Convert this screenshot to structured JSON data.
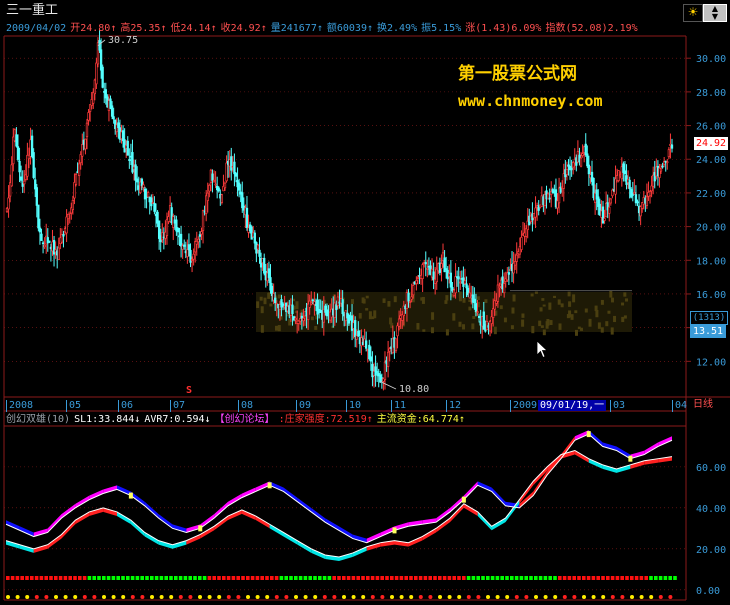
{
  "stock_name": "三一重工",
  "header_stats": [
    {
      "text": "2009/04/02",
      "color": "#3a9bd8"
    },
    {
      "text": "开24.80↑",
      "color": "#ff5050"
    },
    {
      "text": "高25.35↑",
      "color": "#ff5050"
    },
    {
      "text": "低24.14↑",
      "color": "#ff5050"
    },
    {
      "text": "收24.92↑",
      "color": "#ff5050"
    },
    {
      "text": "量241677↑",
      "color": "#3a9bd8"
    },
    {
      "text": "额60039↑",
      "color": "#3a9bd8"
    },
    {
      "text": "换2.49%",
      "color": "#3a9bd8"
    },
    {
      "text": "振5.15%",
      "color": "#3a9bd8"
    },
    {
      "text": "涨(1.43)6.09%",
      "color": "#ff5050"
    },
    {
      "text": "指数(52.08)2.19%",
      "color": "#ff5050"
    }
  ],
  "watermark": {
    "line1": "第一股票公式网",
    "line2": "www.chnmoney.com"
  },
  "price_labels": {
    "high": "30.75",
    "low": "10.80",
    "current": "24.92",
    "count": "(1313)",
    "level": "13.51"
  },
  "s_marker": "S",
  "indicator_header": [
    {
      "text": "创幻双雄(10)",
      "color": "#9aa0a8"
    },
    {
      "text": "SL1:33.844↓",
      "color": "#ffffff"
    },
    {
      "text": "AVR7:0.594↓",
      "color": "#ffffff"
    },
    {
      "text": "【创幻论坛】",
      "color": "#ff44ff"
    },
    {
      "text": ":庄家强度:72.519↑",
      "color": "#ff3030"
    },
    {
      "text": "主流资金:64.774↑",
      "color": "#ffff40"
    }
  ],
  "time_axis": {
    "labels": [
      "2008",
      "05",
      "06",
      "07",
      "08",
      "09",
      "10",
      "11",
      "12",
      "2009",
      "03",
      "04"
    ],
    "highlight": "09/01/19,一",
    "period": "日线"
  },
  "chart_data": [
    {
      "type": "candlestick",
      "title": "三一重工",
      "x_range": [
        "2008",
        "2009/04/02"
      ],
      "y_ticks": [
        12,
        14,
        16,
        18,
        20,
        22,
        24,
        26,
        28,
        30
      ],
      "ylim": [
        10,
        31.2
      ],
      "grid": true,
      "annotations": {
        "high": 30.75,
        "low": 10.8,
        "last_close": 24.92,
        "level": 13.51
      },
      "last_bar": {
        "date": "2009/04/02",
        "open": 24.8,
        "high": 25.35,
        "low": 24.14,
        "close": 24.92
      },
      "trend_points": [
        [
          0,
          21
        ],
        [
          5,
          26
        ],
        [
          10,
          22
        ],
        [
          15,
          25
        ],
        [
          20,
          20
        ],
        [
          25,
          19
        ],
        [
          32,
          18.5
        ],
        [
          40,
          21
        ],
        [
          47,
          24
        ],
        [
          52,
          26.5
        ],
        [
          56,
          29
        ],
        [
          58,
          30.75
        ],
        [
          62,
          28
        ],
        [
          68,
          26.5
        ],
        [
          76,
          24.5
        ],
        [
          84,
          22.5
        ],
        [
          92,
          21.5
        ],
        [
          98,
          19
        ],
        [
          104,
          21
        ],
        [
          110,
          19
        ],
        [
          118,
          18
        ],
        [
          124,
          20
        ],
        [
          130,
          23
        ],
        [
          136,
          22
        ],
        [
          142,
          24
        ],
        [
          148,
          22
        ],
        [
          154,
          20
        ],
        [
          160,
          18.5
        ],
        [
          166,
          17
        ],
        [
          172,
          15.5
        ],
        [
          180,
          15
        ],
        [
          188,
          14.5
        ],
        [
          196,
          15.5
        ],
        [
          204,
          14.5
        ],
        [
          212,
          15.5
        ],
        [
          220,
          14
        ],
        [
          228,
          13
        ],
        [
          234,
          11.2
        ],
        [
          238,
          10.8
        ],
        [
          242,
          12
        ],
        [
          248,
          13.5
        ],
        [
          254,
          15.5
        ],
        [
          260,
          16.5
        ],
        [
          266,
          17.5
        ],
        [
          272,
          17
        ],
        [
          278,
          18
        ],
        [
          284,
          16.5
        ],
        [
          290,
          17
        ],
        [
          296,
          15.5
        ],
        [
          302,
          14.5
        ],
        [
          306,
          14
        ],
        [
          312,
          16
        ],
        [
          318,
          17
        ],
        [
          324,
          18
        ],
        [
          330,
          19.5
        ],
        [
          336,
          21
        ],
        [
          344,
          22
        ],
        [
          350,
          21.5
        ],
        [
          356,
          23
        ],
        [
          362,
          24
        ],
        [
          368,
          24.5
        ],
        [
          374,
          22
        ],
        [
          380,
          20.5
        ],
        [
          386,
          22
        ],
        [
          392,
          23.5
        ],
        [
          398,
          22
        ],
        [
          404,
          21
        ],
        [
          410,
          22.5
        ],
        [
          416,
          23.5
        ],
        [
          420,
          24
        ],
        [
          424,
          24.92
        ]
      ]
    },
    {
      "type": "line",
      "title": "创幻双雄(10)",
      "y_ticks": [
        0,
        20,
        40,
        60
      ],
      "ylim": [
        -4,
        78
      ],
      "series": [
        {
          "name": "庄家强度",
          "last": 72.519,
          "values": [
            32,
            29,
            26,
            28,
            35,
            40,
            44,
            47,
            49,
            46,
            41,
            35,
            30,
            28,
            30,
            35,
            41,
            45,
            48,
            51,
            48,
            43,
            38,
            33,
            29,
            25,
            23,
            26,
            29,
            31,
            32,
            33,
            38,
            44,
            51,
            48,
            41,
            40,
            46,
            56,
            64,
            73,
            76,
            70,
            68,
            64,
            66,
            70,
            73
          ]
        },
        {
          "name": "主流资金",
          "last": 64.774,
          "values": [
            24,
            22,
            20,
            22,
            27,
            34,
            38,
            40,
            38,
            34,
            28,
            24,
            22,
            24,
            27,
            31,
            36,
            39,
            36,
            32,
            28,
            24,
            20,
            17,
            16,
            18,
            21,
            23,
            24,
            23,
            26,
            30,
            35,
            42,
            38,
            31,
            35,
            44,
            53,
            60,
            66,
            68,
            64,
            61,
            59,
            61,
            63,
            64,
            65
          ]
        }
      ]
    }
  ]
}
